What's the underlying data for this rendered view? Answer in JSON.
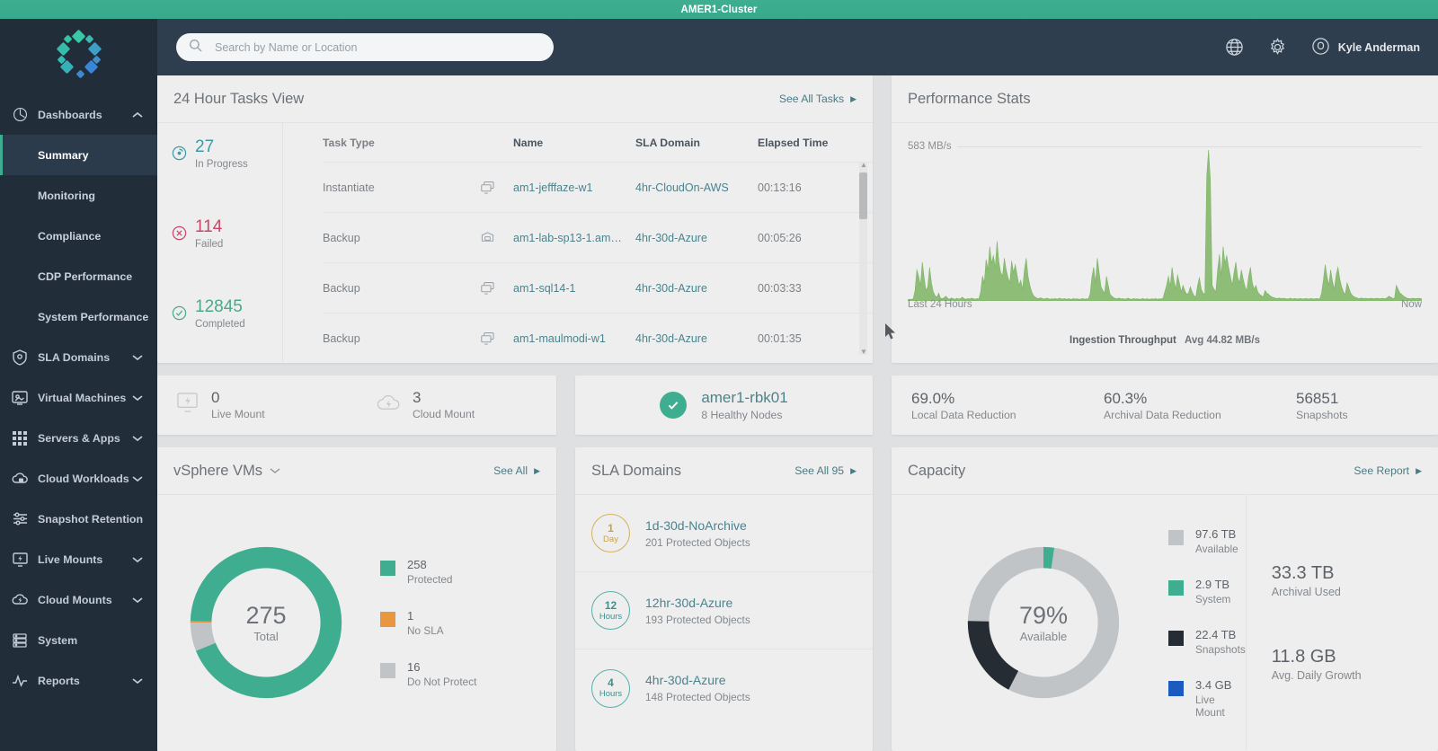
{
  "cluster_bar": {
    "title": "AMER1-Cluster"
  },
  "search": {
    "placeholder": "Search by Name or Location",
    "icon": "search-icon"
  },
  "header": {
    "globe_icon": "globe-icon",
    "gear_icon": "gear-icon",
    "avatar_icon": "user-avatar-icon",
    "user_name": "Kyle Anderman"
  },
  "sidebar": {
    "logo": "app-logo",
    "items": [
      {
        "label": "Dashboards",
        "icon": "dashboard-icon",
        "expanded": true,
        "chevron": "chevron-up"
      },
      {
        "label": "SLA Domains",
        "icon": "shield-icon",
        "expanded": false,
        "chevron": "chevron-down"
      },
      {
        "label": "Virtual Machines",
        "icon": "monitor-icon",
        "expanded": false,
        "chevron": "chevron-down"
      },
      {
        "label": "Servers & Apps",
        "icon": "grid-apps-icon",
        "expanded": false,
        "chevron": "chevron-down"
      },
      {
        "label": "Cloud Workloads",
        "icon": "cloud-lock-icon",
        "expanded": false,
        "chevron": "chevron-down"
      },
      {
        "label": "Snapshot Retention",
        "icon": "sliders-icon",
        "expanded": false,
        "chevron": ""
      },
      {
        "label": "Live Mounts",
        "icon": "live-mount-icon",
        "expanded": false,
        "chevron": "chevron-down"
      },
      {
        "label": "Cloud Mounts",
        "icon": "cloud-bolt-icon",
        "expanded": false,
        "chevron": "chevron-down"
      },
      {
        "label": "System",
        "icon": "server-icon",
        "expanded": false,
        "chevron": ""
      },
      {
        "label": "Reports",
        "icon": "activity-icon",
        "expanded": false,
        "chevron": "chevron-down"
      }
    ],
    "dashboards_sub": [
      {
        "label": "Summary",
        "active": true
      },
      {
        "label": "Monitoring",
        "active": false
      },
      {
        "label": "Compliance",
        "active": false
      },
      {
        "label": "CDP Performance",
        "active": false
      },
      {
        "label": "System Performance",
        "active": false
      }
    ]
  },
  "tasks": {
    "title": "24 Hour Tasks View",
    "see_all_label": "See All Tasks",
    "summary": [
      {
        "value": "27",
        "label": "In Progress",
        "color": "#3c9aa8",
        "icon": "in-progress-icon"
      },
      {
        "value": "114",
        "label": "Failed",
        "color": "#c8476a",
        "icon": "failed-icon"
      },
      {
        "value": "12845",
        "label": "Completed",
        "color": "#4aa98a",
        "icon": "completed-icon"
      }
    ],
    "columns": [
      "Task Type",
      "",
      "Name",
      "SLA Domain",
      "Elapsed Time"
    ],
    "rows": [
      {
        "type": "Instantiate",
        "icon": "vm-icon",
        "name": "am1-jefffaze-w1",
        "sla": "4hr-CloudOn-AWS",
        "time": "00:13:16"
      },
      {
        "type": "Backup",
        "icon": "host-icon",
        "name": "am1-lab-sp13-1.am…",
        "sla": "4hr-30d-Azure",
        "time": "00:05:26"
      },
      {
        "type": "Backup",
        "icon": "vm-icon",
        "name": "am1-sql14-1",
        "sla": "4hr-30d-Azure",
        "time": "00:03:33"
      },
      {
        "type": "Backup",
        "icon": "vm-icon",
        "name": "am1-maulmodi-w1",
        "sla": "4hr-30d-Azure",
        "time": "00:01:35"
      }
    ]
  },
  "performance": {
    "title": "Performance Stats",
    "y_max_label": "583 MB/s",
    "x_left_label": "Last 24 Hours",
    "x_right_label": "Now",
    "legend_label": "Ingestion Throughput",
    "legend_avg": "Avg 44.82 MB/s"
  },
  "chart_data": [
    {
      "type": "area",
      "title": "Performance Stats",
      "series_name": "Ingestion Throughput",
      "ylabel": "MB/s",
      "ylim": [
        0,
        583
      ],
      "y_tick_labels": [
        "583 MB/s"
      ],
      "x_tick_labels": [
        "Last 24 Hours",
        "Now"
      ],
      "average": 44.82,
      "average_label": "Avg 44.82 MB/s",
      "color": "#7cb463",
      "grid": true,
      "values": [
        4,
        6,
        5,
        8,
        40,
        120,
        95,
        60,
        150,
        90,
        40,
        55,
        130,
        70,
        35,
        20,
        14,
        30,
        10,
        8,
        12,
        18,
        9,
        7,
        11,
        8,
        6,
        10,
        7,
        9,
        14,
        8,
        6,
        9,
        7,
        10,
        8,
        6,
        9,
        7,
        35,
        95,
        70,
        160,
        120,
        210,
        145,
        175,
        130,
        230,
        150,
        110,
        95,
        165,
        120,
        90,
        70,
        155,
        110,
        140,
        100,
        60,
        80,
        45,
        120,
        165,
        95,
        60,
        35,
        20,
        14,
        10,
        9,
        12,
        8,
        7,
        10,
        9,
        6,
        8,
        7,
        9,
        6,
        10,
        8,
        7,
        9,
        6,
        8,
        7,
        6,
        9,
        7,
        8,
        6,
        7,
        9,
        6,
        8,
        7,
        25,
        90,
        130,
        70,
        165,
        110,
        55,
        40,
        30,
        95,
        60,
        25,
        18,
        12,
        9,
        8,
        11,
        7,
        9,
        6,
        8,
        10,
        7,
        6,
        9,
        7,
        8,
        6,
        7,
        9,
        6,
        8,
        7,
        6,
        8,
        7,
        9,
        6,
        8,
        7,
        10,
        35,
        60,
        95,
        55,
        130,
        80,
        45,
        100,
        70,
        35,
        60,
        40,
        25,
        30,
        55,
        35,
        20,
        15,
        60,
        90,
        45,
        30,
        25,
        480,
        583,
        470,
        60,
        45,
        35,
        120,
        180,
        95,
        210,
        145,
        175,
        130,
        95,
        60,
        110,
        150,
        90,
        70,
        120,
        85,
        55,
        40,
        95,
        130,
        70,
        45,
        60,
        35,
        25,
        20,
        15,
        40,
        30,
        25,
        18,
        14,
        12,
        10,
        9,
        11,
        8,
        10,
        9,
        7,
        8,
        10,
        7,
        9,
        8,
        7,
        9,
        8,
        7,
        9,
        8,
        7,
        9,
        8,
        7,
        9,
        8,
        7,
        30,
        80,
        140,
        95,
        60,
        120,
        75,
        45,
        100,
        130,
        85,
        55,
        35,
        25,
        70,
        50,
        30,
        20,
        15,
        12,
        10,
        9,
        11,
        8,
        10,
        9,
        8,
        10,
        9,
        8,
        10,
        9,
        8,
        10,
        9,
        8,
        12,
        18,
        14,
        10,
        9,
        60,
        45,
        30,
        25,
        18,
        14,
        10,
        9,
        8,
        10,
        9,
        8,
        10,
        9,
        8
      ]
    },
    {
      "type": "pie",
      "title": "vSphere VMs",
      "center_value": "275",
      "center_label": "Total",
      "labels": [
        "Protected",
        "No SLA",
        "Do Not Protect"
      ],
      "values": [
        258,
        1,
        16
      ],
      "colors": [
        "#3fae90",
        "#e8973f",
        "#c0c4c7"
      ]
    },
    {
      "type": "pie",
      "title": "Capacity",
      "center_value": "79%",
      "center_label": "Available",
      "labels": [
        "Available",
        "System",
        "Snapshots",
        "Live Mount"
      ],
      "value_labels": [
        "97.6 TB",
        "2.9 TB",
        "22.4 TB",
        "3.4 GB"
      ],
      "values": [
        97.6,
        2.9,
        22.4,
        0.0034
      ],
      "unit": "TB",
      "colors": [
        "#c0c4c7",
        "#3fae90",
        "#252c33",
        "#1b5bbf"
      ]
    }
  ],
  "mounts": {
    "live": {
      "value": "0",
      "label": "Live Mount",
      "icon": "live-mount-icon"
    },
    "cloud": {
      "value": "3",
      "label": "Cloud Mount",
      "icon": "cloud-mount-icon"
    }
  },
  "cluster_health": {
    "status_icon": "check-circle-icon",
    "name": "amer1-rbk01",
    "sub": "8 Healthy Nodes"
  },
  "reduction": [
    {
      "value": "69.0%",
      "label": "Local Data Reduction"
    },
    {
      "value": "60.3%",
      "label": "Archival Data Reduction"
    },
    {
      "value": "56851",
      "label": "Snapshots"
    }
  ],
  "vms": {
    "title": "vSphere VMs",
    "dropdown_icon": "chevron-down-icon",
    "see_all_label": "See All",
    "total": "275",
    "total_label": "Total",
    "legend": [
      {
        "value": "258",
        "label": "Protected",
        "color": "#3fae90"
      },
      {
        "value": "1",
        "label": "No SLA",
        "color": "#e8973f"
      },
      {
        "value": "16",
        "label": "Do Not Protect",
        "color": "#c0c4c7"
      }
    ]
  },
  "sla_domains": {
    "title": "SLA Domains",
    "see_all_label": "See All 95",
    "rows": [
      {
        "badge_num": "1",
        "badge_unit": "Day",
        "name": "1d-30d-NoArchive",
        "objects": "201 Protected Objects",
        "color": "#d4b25a"
      },
      {
        "badge_num": "12",
        "badge_unit": "Hours",
        "name": "12hr-30d-Azure",
        "objects": "193 Protected Objects",
        "color": "#57b0ab"
      },
      {
        "badge_num": "4",
        "badge_unit": "Hours",
        "name": "4hr-30d-Azure",
        "objects": "148 Protected Objects",
        "color": "#57b0ab"
      }
    ]
  },
  "capacity": {
    "title": "Capacity",
    "see_report_label": "See Report",
    "center_value": "79%",
    "center_label": "Available",
    "legend": [
      {
        "value": "97.6 TB",
        "label": "Available",
        "color": "#c0c4c7"
      },
      {
        "value": "2.9 TB",
        "label": "System",
        "color": "#3fae90"
      },
      {
        "value": "22.4 TB",
        "label": "Snapshots",
        "color": "#252c33"
      },
      {
        "value": "3.4 GB",
        "label": "Live Mount",
        "color": "#1b5bbf"
      }
    ],
    "stats": [
      {
        "value": "33.3 TB",
        "label": "Archival Used"
      },
      {
        "value": "11.8 GB",
        "label": "Avg. Daily Growth"
      }
    ]
  }
}
